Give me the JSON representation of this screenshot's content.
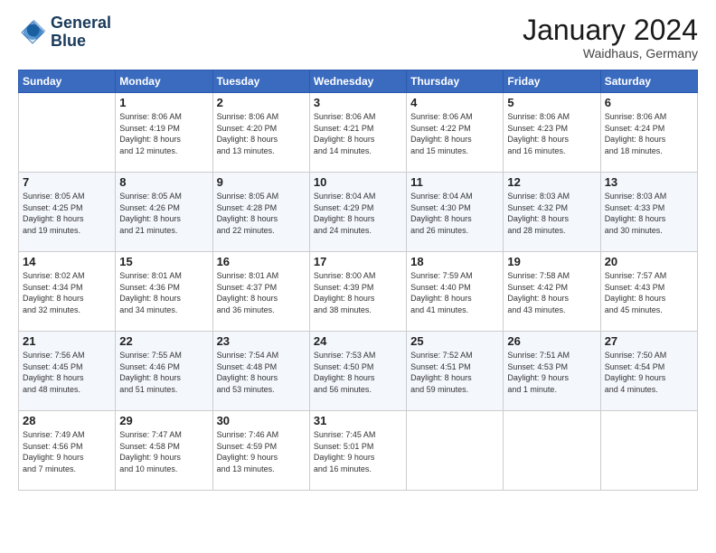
{
  "header": {
    "logo_line1": "General",
    "logo_line2": "Blue",
    "month_title": "January 2024",
    "location": "Waidhaus, Germany"
  },
  "weekdays": [
    "Sunday",
    "Monday",
    "Tuesday",
    "Wednesday",
    "Thursday",
    "Friday",
    "Saturday"
  ],
  "weeks": [
    [
      {
        "day": "",
        "info": ""
      },
      {
        "day": "1",
        "info": "Sunrise: 8:06 AM\nSunset: 4:19 PM\nDaylight: 8 hours\nand 12 minutes."
      },
      {
        "day": "2",
        "info": "Sunrise: 8:06 AM\nSunset: 4:20 PM\nDaylight: 8 hours\nand 13 minutes."
      },
      {
        "day": "3",
        "info": "Sunrise: 8:06 AM\nSunset: 4:21 PM\nDaylight: 8 hours\nand 14 minutes."
      },
      {
        "day": "4",
        "info": "Sunrise: 8:06 AM\nSunset: 4:22 PM\nDaylight: 8 hours\nand 15 minutes."
      },
      {
        "day": "5",
        "info": "Sunrise: 8:06 AM\nSunset: 4:23 PM\nDaylight: 8 hours\nand 16 minutes."
      },
      {
        "day": "6",
        "info": "Sunrise: 8:06 AM\nSunset: 4:24 PM\nDaylight: 8 hours\nand 18 minutes."
      }
    ],
    [
      {
        "day": "7",
        "info": "Sunrise: 8:05 AM\nSunset: 4:25 PM\nDaylight: 8 hours\nand 19 minutes."
      },
      {
        "day": "8",
        "info": "Sunrise: 8:05 AM\nSunset: 4:26 PM\nDaylight: 8 hours\nand 21 minutes."
      },
      {
        "day": "9",
        "info": "Sunrise: 8:05 AM\nSunset: 4:28 PM\nDaylight: 8 hours\nand 22 minutes."
      },
      {
        "day": "10",
        "info": "Sunrise: 8:04 AM\nSunset: 4:29 PM\nDaylight: 8 hours\nand 24 minutes."
      },
      {
        "day": "11",
        "info": "Sunrise: 8:04 AM\nSunset: 4:30 PM\nDaylight: 8 hours\nand 26 minutes."
      },
      {
        "day": "12",
        "info": "Sunrise: 8:03 AM\nSunset: 4:32 PM\nDaylight: 8 hours\nand 28 minutes."
      },
      {
        "day": "13",
        "info": "Sunrise: 8:03 AM\nSunset: 4:33 PM\nDaylight: 8 hours\nand 30 minutes."
      }
    ],
    [
      {
        "day": "14",
        "info": "Sunrise: 8:02 AM\nSunset: 4:34 PM\nDaylight: 8 hours\nand 32 minutes."
      },
      {
        "day": "15",
        "info": "Sunrise: 8:01 AM\nSunset: 4:36 PM\nDaylight: 8 hours\nand 34 minutes."
      },
      {
        "day": "16",
        "info": "Sunrise: 8:01 AM\nSunset: 4:37 PM\nDaylight: 8 hours\nand 36 minutes."
      },
      {
        "day": "17",
        "info": "Sunrise: 8:00 AM\nSunset: 4:39 PM\nDaylight: 8 hours\nand 38 minutes."
      },
      {
        "day": "18",
        "info": "Sunrise: 7:59 AM\nSunset: 4:40 PM\nDaylight: 8 hours\nand 41 minutes."
      },
      {
        "day": "19",
        "info": "Sunrise: 7:58 AM\nSunset: 4:42 PM\nDaylight: 8 hours\nand 43 minutes."
      },
      {
        "day": "20",
        "info": "Sunrise: 7:57 AM\nSunset: 4:43 PM\nDaylight: 8 hours\nand 45 minutes."
      }
    ],
    [
      {
        "day": "21",
        "info": "Sunrise: 7:56 AM\nSunset: 4:45 PM\nDaylight: 8 hours\nand 48 minutes."
      },
      {
        "day": "22",
        "info": "Sunrise: 7:55 AM\nSunset: 4:46 PM\nDaylight: 8 hours\nand 51 minutes."
      },
      {
        "day": "23",
        "info": "Sunrise: 7:54 AM\nSunset: 4:48 PM\nDaylight: 8 hours\nand 53 minutes."
      },
      {
        "day": "24",
        "info": "Sunrise: 7:53 AM\nSunset: 4:50 PM\nDaylight: 8 hours\nand 56 minutes."
      },
      {
        "day": "25",
        "info": "Sunrise: 7:52 AM\nSunset: 4:51 PM\nDaylight: 8 hours\nand 59 minutes."
      },
      {
        "day": "26",
        "info": "Sunrise: 7:51 AM\nSunset: 4:53 PM\nDaylight: 9 hours\nand 1 minute."
      },
      {
        "day": "27",
        "info": "Sunrise: 7:50 AM\nSunset: 4:54 PM\nDaylight: 9 hours\nand 4 minutes."
      }
    ],
    [
      {
        "day": "28",
        "info": "Sunrise: 7:49 AM\nSunset: 4:56 PM\nDaylight: 9 hours\nand 7 minutes."
      },
      {
        "day": "29",
        "info": "Sunrise: 7:47 AM\nSunset: 4:58 PM\nDaylight: 9 hours\nand 10 minutes."
      },
      {
        "day": "30",
        "info": "Sunrise: 7:46 AM\nSunset: 4:59 PM\nDaylight: 9 hours\nand 13 minutes."
      },
      {
        "day": "31",
        "info": "Sunrise: 7:45 AM\nSunset: 5:01 PM\nDaylight: 9 hours\nand 16 minutes."
      },
      {
        "day": "",
        "info": ""
      },
      {
        "day": "",
        "info": ""
      },
      {
        "day": "",
        "info": ""
      }
    ]
  ]
}
